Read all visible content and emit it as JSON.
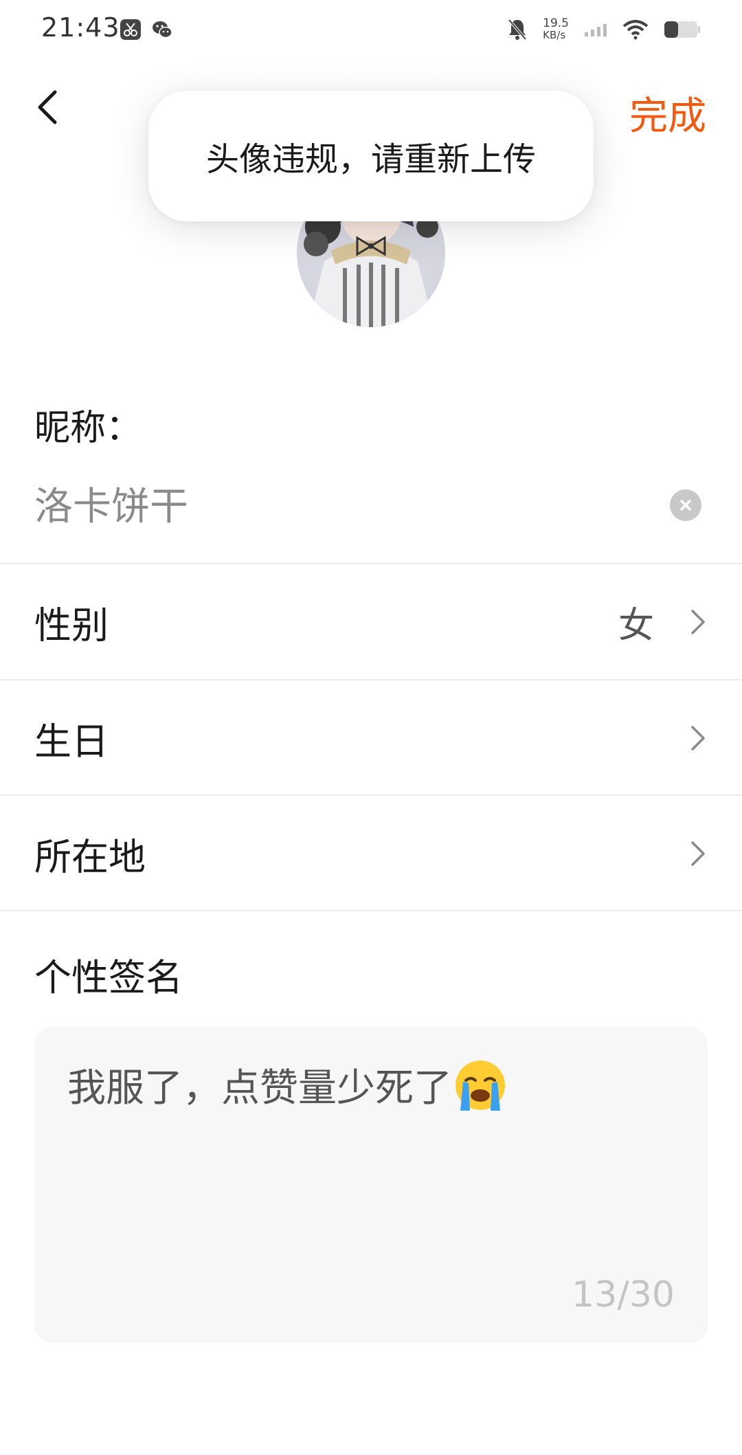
{
  "status_bar": {
    "time": "21:43",
    "net_speed_value": "19.5",
    "net_speed_unit": "KB/s",
    "icons": [
      "scissors-app-icon",
      "wechat-icon",
      "mute-bell-icon",
      "signal-icon",
      "wifi-icon",
      "battery-icon"
    ]
  },
  "header": {
    "done_label": "完成"
  },
  "toast": {
    "message": "头像违规，请重新上传"
  },
  "nickname": {
    "label": "昵称：",
    "value": "洛卡饼干"
  },
  "rows": [
    {
      "label": "性别",
      "value": "女"
    },
    {
      "label": "生日",
      "value": ""
    },
    {
      "label": "所在地",
      "value": ""
    }
  ],
  "signature": {
    "label": "个性签名",
    "text": "我服了，点赞量少死了",
    "emoji": "loudly-crying-face",
    "count": "13/30"
  },
  "colors": {
    "accent": "#f2590f",
    "divider": "#ececec",
    "signature_bg": "#f7f7f7"
  }
}
